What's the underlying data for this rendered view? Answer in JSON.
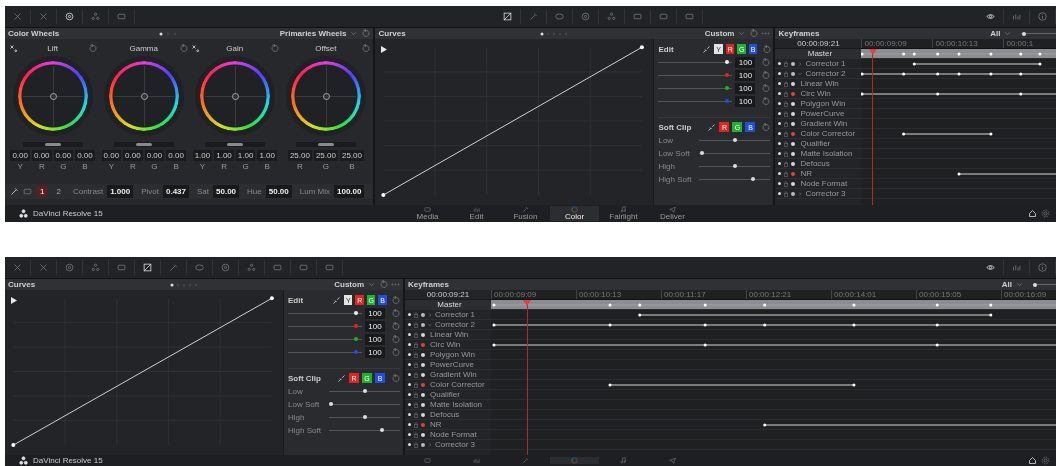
{
  "screens": [
    {
      "toolbar_left": [
        {
          "selected": false
        },
        {
          "selected": false
        },
        {
          "selected": true
        },
        {
          "selected": false
        },
        {
          "selected": false
        }
      ],
      "toolbar_center": [
        {
          "selected": true
        },
        {
          "selected": false
        },
        {
          "selected": false
        },
        {
          "selected": false
        },
        {
          "selected": false
        },
        {
          "selected": false
        },
        {
          "selected": false
        },
        {
          "selected": false
        }
      ],
      "toolbar_right": [
        {
          "selected": true
        },
        {
          "selected": false
        },
        {
          "selected": false
        }
      ],
      "color_wheels": {
        "title": "Color Wheels",
        "mode": "Primaries Wheels",
        "wheels": [
          {
            "name": "Lift",
            "level": 0.5,
            "values": [
              "0.00",
              "0.00",
              "0.00",
              "0.00"
            ],
            "channels": [
              "Y",
              "R",
              "G",
              "B"
            ]
          },
          {
            "name": "Gamma",
            "level": 0.5,
            "values": [
              "0.00",
              "0.00",
              "0.00",
              "0.00"
            ],
            "channels": [
              "Y",
              "R",
              "G",
              "B"
            ]
          },
          {
            "name": "Gain",
            "level": 0.5,
            "values": [
              "1.00",
              "1.00",
              "1.00",
              "1.00"
            ],
            "channels": [
              "Y",
              "R",
              "G",
              "B"
            ]
          },
          {
            "name": "Offset",
            "level": 0.5,
            "values": [
              "25.00",
              "25.00",
              "25.00"
            ],
            "channels": [
              "R",
              "G",
              "B"
            ]
          }
        ],
        "pages": [
          {
            "label": "1",
            "selected": true
          },
          {
            "label": "2",
            "selected": false
          }
        ],
        "adjustments": [
          {
            "label": "Contrast",
            "value": "1.000"
          },
          {
            "label": "Pivot",
            "value": "0.437"
          },
          {
            "label": "Sat",
            "value": "50.00"
          },
          {
            "label": "Hue",
            "value": "50.00"
          },
          {
            "label": "Lum Mix",
            "value": "100.00"
          }
        ]
      },
      "curves": {
        "title": "Curves",
        "preset": "Custom",
        "edit": {
          "label": "Edit",
          "channels": [
            {
              "label": "Y",
              "color": "#e4e4e4"
            },
            {
              "label": "R",
              "color": "#e02424"
            },
            {
              "label": "G",
              "color": "#22b033"
            },
            {
              "label": "B",
              "color": "#1f4fe0"
            }
          ],
          "sliders": [
            {
              "color": "#f0f0f0",
              "level": 0.92,
              "value": "100"
            },
            {
              "color": "#e02424",
              "level": 0.92,
              "value": "100"
            },
            {
              "color": "#22b033",
              "level": 0.92,
              "value": "100"
            },
            {
              "color": "#1f4fe0",
              "level": 0.92,
              "value": "100"
            }
          ]
        },
        "soft_clip": {
          "label": "Soft Clip",
          "channels": [
            {
              "label": "R",
              "color": "#e02424"
            },
            {
              "label": "G",
              "color": "#22b033"
            },
            {
              "label": "B",
              "color": "#1f4fe0"
            }
          ],
          "sliders": [
            {
              "label": "Low",
              "level": 0.5
            },
            {
              "label": "Low Soft",
              "level": 0.03
            },
            {
              "label": "High",
              "level": 0.5
            },
            {
              "label": "High Soft",
              "level": 0.75
            }
          ]
        }
      },
      "keyframes": {
        "title": "Keyframes",
        "filter": "All",
        "zoom": {
          "level": 0.05
        },
        "timecode": "00:00:09:21",
        "playhead": {
          "level": 0.05
        },
        "ruler": [
          "00:00:09:09",
          "00:00:10:13",
          "00:00:1"
        ],
        "tracks": [
          {
            "name": "Master",
            "kind": "master"
          },
          {
            "name": "Corrector 1",
            "kind": "node",
            "expanded": false
          },
          {
            "name": "Corrector 2",
            "kind": "node",
            "expanded": true
          },
          {
            "name": "Linear Win",
            "kind": "tool",
            "color": "#d6d6d6"
          },
          {
            "name": "Circ Win",
            "kind": "tool",
            "color": "#e5403a"
          },
          {
            "name": "Polygon Win",
            "kind": "tool",
            "color": "#d6d6d6"
          },
          {
            "name": "PowerCurve",
            "kind": "tool",
            "color": "#d6d6d6"
          },
          {
            "name": "Gradient Win",
            "kind": "tool",
            "color": "#d6d6d6"
          },
          {
            "name": "Color Corrector",
            "kind": "tool",
            "color": "#e5403a"
          },
          {
            "name": "Qualifier",
            "kind": "tool",
            "color": "#d6d6d6"
          },
          {
            "name": "Matte Isolation",
            "kind": "tool",
            "color": "#d6d6d6"
          },
          {
            "name": "Defocus",
            "kind": "tool",
            "color": "#d6d6d6"
          },
          {
            "name": "NR",
            "kind": "tool",
            "color": "#e5403a"
          },
          {
            "name": "Node Format",
            "kind": "tool",
            "color": "#d6d6d6"
          },
          {
            "name": "Corrector 3",
            "kind": "node",
            "expanded": false
          }
        ]
      },
      "pages": [
        {
          "label": "Media",
          "selected": false
        },
        {
          "label": "Edit",
          "selected": false
        },
        {
          "label": "Fusion",
          "selected": false
        },
        {
          "label": "Color",
          "selected": true
        },
        {
          "label": "Fairlight",
          "selected": false
        },
        {
          "label": "Deliver",
          "selected": false
        }
      ],
      "app_name": "DaVinci Resolve 15"
    },
    {
      "toolbar_left": [
        {
          "selected": false
        },
        {
          "selected": false
        },
        {
          "selected": false
        },
        {
          "selected": false
        },
        {
          "selected": false
        },
        {
          "selected": true
        },
        {
          "selected": false
        },
        {
          "selected": false
        },
        {
          "selected": false
        },
        {
          "selected": false
        },
        {
          "selected": false
        },
        {
          "selected": false
        },
        {
          "selected": false
        }
      ],
      "toolbar_right": [
        {
          "selected": true
        },
        {
          "selected": false
        },
        {
          "selected": false
        }
      ],
      "curves": {
        "title": "Curves",
        "preset": "Custom",
        "edit": {
          "label": "Edit",
          "channels": [
            {
              "label": "Y",
              "color": "#e4e4e4"
            },
            {
              "label": "R",
              "color": "#e02424"
            },
            {
              "label": "G",
              "color": "#22b033"
            },
            {
              "label": "B",
              "color": "#1f4fe0"
            }
          ],
          "sliders": [
            {
              "color": "#f0f0f0",
              "level": 0.92,
              "value": "100"
            },
            {
              "color": "#e02424",
              "level": 0.92,
              "value": "100"
            },
            {
              "color": "#22b033",
              "level": 0.92,
              "value": "100"
            },
            {
              "color": "#1f4fe0",
              "level": 0.92,
              "value": "100"
            }
          ]
        },
        "soft_clip": {
          "label": "Soft Clip",
          "channels": [
            {
              "label": "R",
              "color": "#e02424"
            },
            {
              "label": "G",
              "color": "#22b033"
            },
            {
              "label": "B",
              "color": "#1f4fe0"
            }
          ],
          "sliders": [
            {
              "label": "Low",
              "level": 0.5
            },
            {
              "label": "Low Soft",
              "level": 0.03
            },
            {
              "label": "High",
              "level": 0.5
            },
            {
              "label": "High Soft",
              "level": 0.75
            }
          ]
        }
      },
      "keyframes": {
        "title": "Keyframes",
        "filter": "All",
        "zoom": {
          "level": 0.05
        },
        "timecode": "00:00:09:21",
        "playhead": {
          "level": 0.06
        },
        "ruler": [
          "00:00:09:09",
          "00:00:10:13",
          "00:00:11:17",
          "00:00:12:21",
          "00:00:14:01",
          "00:00:15:05",
          "00:00:16:09"
        ],
        "tracks": [
          {
            "name": "Master",
            "kind": "master"
          },
          {
            "name": "Corrector 1",
            "kind": "node",
            "expanded": false
          },
          {
            "name": "Corrector 2",
            "kind": "node",
            "expanded": true
          },
          {
            "name": "Linear Win",
            "kind": "tool",
            "color": "#d6d6d6"
          },
          {
            "name": "Circ Win",
            "kind": "tool",
            "color": "#e5403a"
          },
          {
            "name": "Polygon Win",
            "kind": "tool",
            "color": "#d6d6d6"
          },
          {
            "name": "PowerCurve",
            "kind": "tool",
            "color": "#d6d6d6"
          },
          {
            "name": "Gradient Win",
            "kind": "tool",
            "color": "#d6d6d6"
          },
          {
            "name": "Color Corrector",
            "kind": "tool",
            "color": "#e5403a"
          },
          {
            "name": "Qualifier",
            "kind": "tool",
            "color": "#d6d6d6"
          },
          {
            "name": "Matte Isolation",
            "kind": "tool",
            "color": "#d6d6d6"
          },
          {
            "name": "Defocus",
            "kind": "tool",
            "color": "#d6d6d6"
          },
          {
            "name": "NR",
            "kind": "tool",
            "color": "#e5403a"
          },
          {
            "name": "Node Format",
            "kind": "tool",
            "color": "#d6d6d6"
          },
          {
            "name": "Corrector 3",
            "kind": "node",
            "expanded": false
          }
        ]
      },
      "pages": [
        {
          "selected": false
        },
        {
          "selected": false
        },
        {
          "selected": false
        },
        {
          "selected": true
        },
        {
          "selected": false
        },
        {
          "selected": false
        }
      ],
      "app_name": "DaVinci Resolve 15"
    }
  ]
}
